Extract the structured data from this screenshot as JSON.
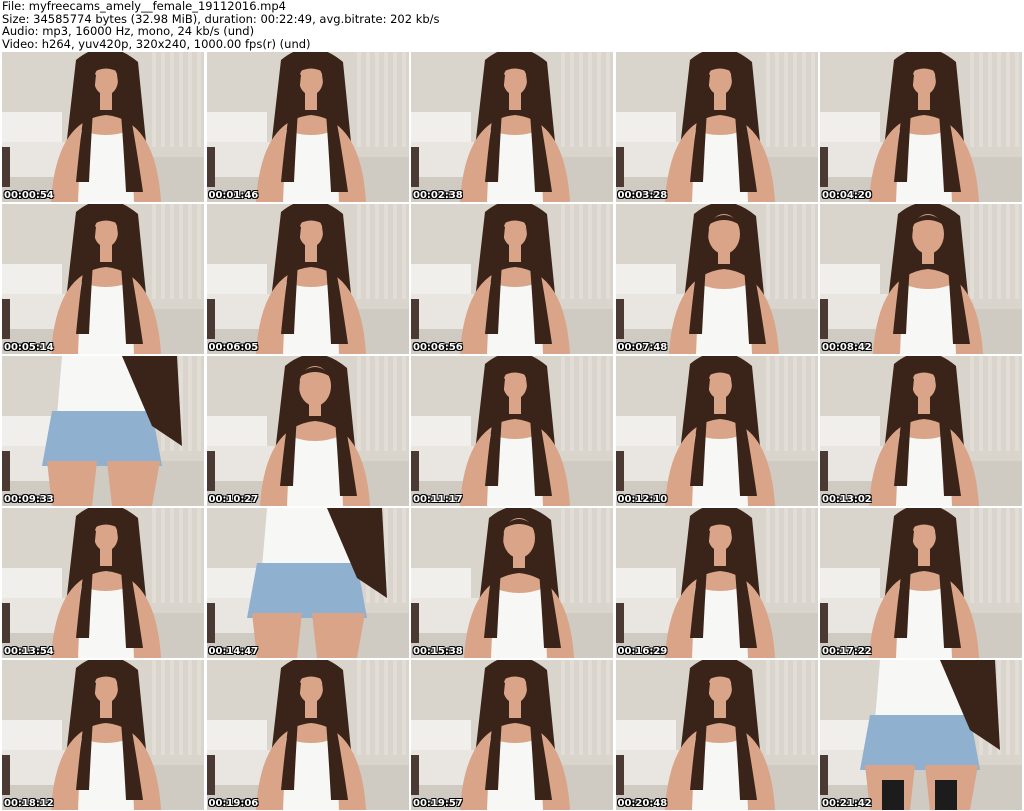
{
  "header": {
    "file_line": "File: myfreecams_amely__female_19112016.mp4",
    "size_line": "Size: 34585774 bytes (32.98 MiB), duration: 00:22:49, avg.bitrate: 202 kb/s",
    "audio_line": "Audio: mp3, 16000 Hz, mono, 24 kb/s (und)",
    "video_line": "Video: h264, yuv420p, 320x240, 1000.00 fps(r) (und)"
  },
  "thumbnails": [
    {
      "timestamp": "00:00:54",
      "variant": "portrait"
    },
    {
      "timestamp": "00:01:46",
      "variant": "portrait"
    },
    {
      "timestamp": "00:02:38",
      "variant": "portrait"
    },
    {
      "timestamp": "00:03:28",
      "variant": "portrait"
    },
    {
      "timestamp": "00:04:20",
      "variant": "portrait"
    },
    {
      "timestamp": "00:05:14",
      "variant": "portrait"
    },
    {
      "timestamp": "00:06:05",
      "variant": "portrait"
    },
    {
      "timestamp": "00:06:56",
      "variant": "portrait"
    },
    {
      "timestamp": "00:07:48",
      "variant": "closeup"
    },
    {
      "timestamp": "00:08:42",
      "variant": "closeup"
    },
    {
      "timestamp": "00:09:33",
      "variant": "back"
    },
    {
      "timestamp": "00:10:27",
      "variant": "closeup"
    },
    {
      "timestamp": "00:11:17",
      "variant": "portrait"
    },
    {
      "timestamp": "00:12:10",
      "variant": "portrait"
    },
    {
      "timestamp": "00:13:02",
      "variant": "portrait"
    },
    {
      "timestamp": "00:13:54",
      "variant": "portrait"
    },
    {
      "timestamp": "00:14:47",
      "variant": "back"
    },
    {
      "timestamp": "00:15:38",
      "variant": "closeup"
    },
    {
      "timestamp": "00:16:29",
      "variant": "portrait"
    },
    {
      "timestamp": "00:17:22",
      "variant": "portrait"
    },
    {
      "timestamp": "00:18:12",
      "variant": "portrait"
    },
    {
      "timestamp": "00:19:06",
      "variant": "portrait"
    },
    {
      "timestamp": "00:19:57",
      "variant": "portrait"
    },
    {
      "timestamp": "00:20:48",
      "variant": "portrait"
    },
    {
      "timestamp": "00:21:42",
      "variant": "standing"
    }
  ],
  "colors": {
    "wall": "#d9d4cc",
    "couch": "#f1efec",
    "floor": "#cfcac2",
    "hair": "#3a2419",
    "skin": "#d9a487",
    "top": "#f7f7f5",
    "shorts": "#8fb1cf"
  }
}
